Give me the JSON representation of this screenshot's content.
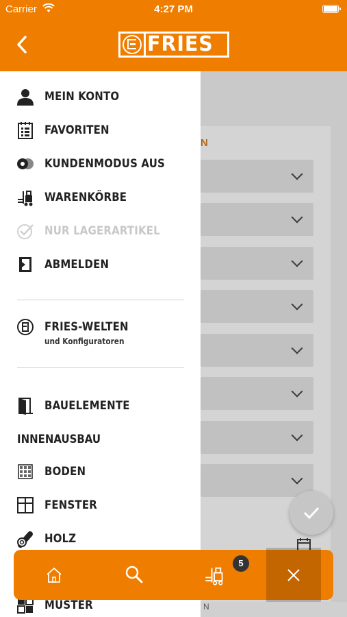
{
  "status_bar": {
    "carrier": "Carrier",
    "time": "4:27 PM"
  },
  "header": {
    "logo_text": "FRIES"
  },
  "background": {
    "section_letter": "N",
    "footer_letter": "N",
    "row_count": 8
  },
  "menu": {
    "account": "MEIN KONTO",
    "favorites": "FAVORITEN",
    "customer_mode": "KUNDENMODUS AUS",
    "carts": "WARENKÖRBE",
    "stock_only": "NUR LAGERARTIKEL",
    "logout": "ABMELDEN",
    "worlds_title": "FRIES-WELTEN",
    "worlds_subtitle": "und Konfiguratoren",
    "building_elements": "BAUELEMENTE",
    "interior_section": "INNENAUSBAU",
    "floor": "BODEN",
    "window": "FENSTER",
    "wood": "HOLZ",
    "samples": "MUSTER"
  },
  "bottom_bar": {
    "cart_badge": "5"
  },
  "colors": {
    "brand_orange": "#ee7d00",
    "text_dark": "#222222",
    "disabled": "#c8c8c8"
  }
}
